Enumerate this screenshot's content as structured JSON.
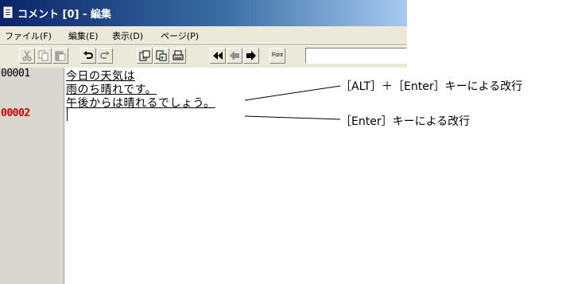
{
  "window": {
    "title": "コメント [0] - 編集",
    "icon": "notepad-icon"
  },
  "menu": [
    {
      "label": "ファイル(F)"
    },
    {
      "label": "編集(E)"
    },
    {
      "label": "表示(D)"
    },
    {
      "label": "ページ(P)"
    }
  ],
  "toolbar": {
    "buttons": [
      {
        "icon": "cut-icon"
      },
      {
        "icon": "copy-icon"
      },
      {
        "icon": "paste-icon"
      },
      {
        "icon": "undo-icon"
      },
      {
        "icon": "redo-icon"
      },
      {
        "icon": "import-icon"
      },
      {
        "icon": "export-icon"
      },
      {
        "icon": "print-icon"
      },
      {
        "icon": "first-page-icon"
      },
      {
        "icon": "previous-page-icon"
      },
      {
        "icon": "next-page-icon"
      }
    ],
    "font_label": "Font",
    "input_value": ""
  },
  "gutter": {
    "line1": "00001",
    "line2": "00002",
    "line1_color": "#000000",
    "line2_color": "#d00000"
  },
  "editor": {
    "lines": [
      "今日の天気は",
      "雨のち晴れです。",
      "午後からは晴れるでしょう。",
      ""
    ]
  },
  "callouts": {
    "alt_enter": "［ALT］＋［Enter］キーによる改行",
    "enter": "［Enter］キーによる改行"
  }
}
